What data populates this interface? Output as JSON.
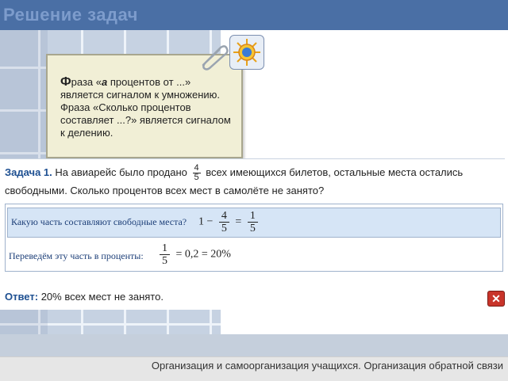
{
  "header": {
    "title": "Решение задач"
  },
  "note": {
    "line1_strong": "Ф",
    "line1_rest": "раза «",
    "a_symbol": "a",
    "line1_tail": " процентов от ...» является сигналом к умножению. Фраза «Сколько процентов составляет ...?» является сигналом к делению."
  },
  "task": {
    "label": "Задача 1.",
    "text_before": "На авиарейс было продано",
    "frac_num": "4",
    "frac_den": "5",
    "text_after": "всех имеющихся билетов, остальные места остались свободными. Сколько процентов всех мест в самолёте не занято?"
  },
  "work": {
    "q1": "Какую часть составляют свободные места?",
    "q1_one": "1 −",
    "q1_frac_num": "4",
    "q1_frac_den": "5",
    "q1_eq": "=",
    "q1_res_num": "1",
    "q1_res_den": "5",
    "q2": "Переведём эту часть в проценты:",
    "q2_frac_num": "1",
    "q2_frac_den": "5",
    "q2_rest": "= 0,2 = 20%"
  },
  "answer": {
    "label": "Ответ:",
    "text": "20% всех мест не занято."
  },
  "close_button": {
    "label": "✕"
  },
  "footer": {
    "text": "Организация и самоорганизация учащихся. Организация обратной связи"
  },
  "colors": {
    "header_bg": "#4a6fa5",
    "accent_blue": "#1d4f91",
    "close_red": "#c8342a"
  }
}
